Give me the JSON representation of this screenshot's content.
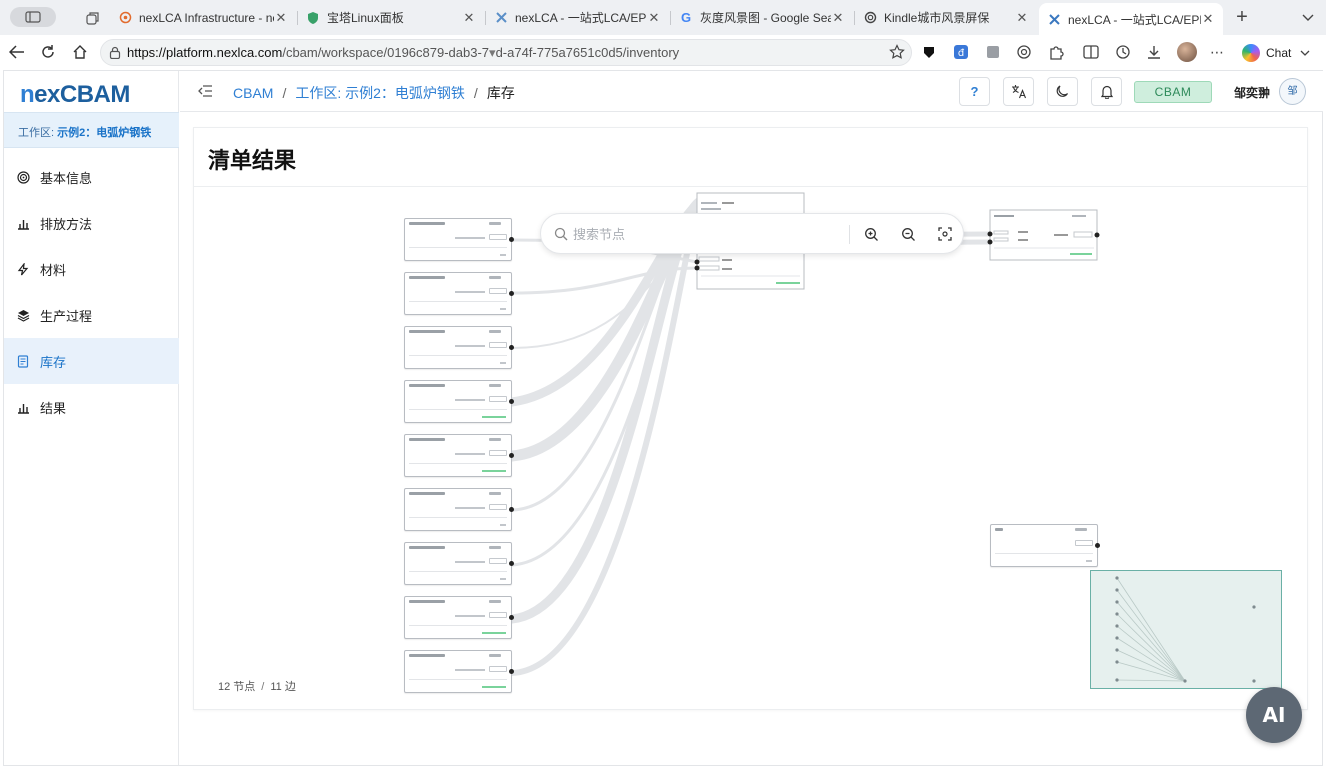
{
  "browser": {
    "tabs": [
      {
        "label": "nexLCA Infrastructure - ne",
        "icon": "gear-favicon-icon",
        "active": false
      },
      {
        "label": "宝塔Linux面板",
        "icon": "shield-favicon-icon",
        "active": false
      },
      {
        "label": "nexLCA - 一站式LCA/EPD平",
        "icon": "nexlca-favicon-icon",
        "active": false
      },
      {
        "label": "灰度风景图 - Google Search",
        "icon": "google-favicon-icon",
        "active": false
      },
      {
        "label": "Kindle城市风景屏保",
        "icon": "openai-favicon-icon",
        "active": false
      },
      {
        "label": "nexLCA - 一站式LCA/EPD平",
        "icon": "nexlca-favicon-icon",
        "active": true
      }
    ],
    "url_host": "https://platform.nexlca.com",
    "url_path": "/cbam/workspace/0196c879-dab3-7",
    "url_path2": "d-a74f-775a7651c0d5/inventory",
    "chat_label": "Chat"
  },
  "sidebar": {
    "brand_prefix": "n",
    "brand_rest": "exCBAM",
    "workspace_prefix": "工作区: ",
    "workspace_name": "示例2：电弧炉钢铁",
    "items": [
      {
        "label": "基本信息",
        "icon": "target-icon"
      },
      {
        "label": "排放方法",
        "icon": "bar-chart-icon"
      },
      {
        "label": "材料",
        "icon": "bolt-icon"
      },
      {
        "label": "生产过程",
        "icon": "layers-icon"
      },
      {
        "label": "库存",
        "icon": "document-icon",
        "active": true
      },
      {
        "label": "结果",
        "icon": "bar-chart-icon"
      }
    ]
  },
  "header": {
    "breadcrumb": [
      "CBAM",
      "工作区: 示例2：电弧炉钢铁",
      "库存"
    ],
    "help_label": "?",
    "cbam_tag": "CBAM",
    "username": "邹奕翀",
    "avatar_text": "邹"
  },
  "main": {
    "title": "清单结果",
    "search_placeholder": "搜索节点",
    "nodes_count": "12 节点",
    "edges_count": "11 边",
    "ai_label": "AI"
  }
}
